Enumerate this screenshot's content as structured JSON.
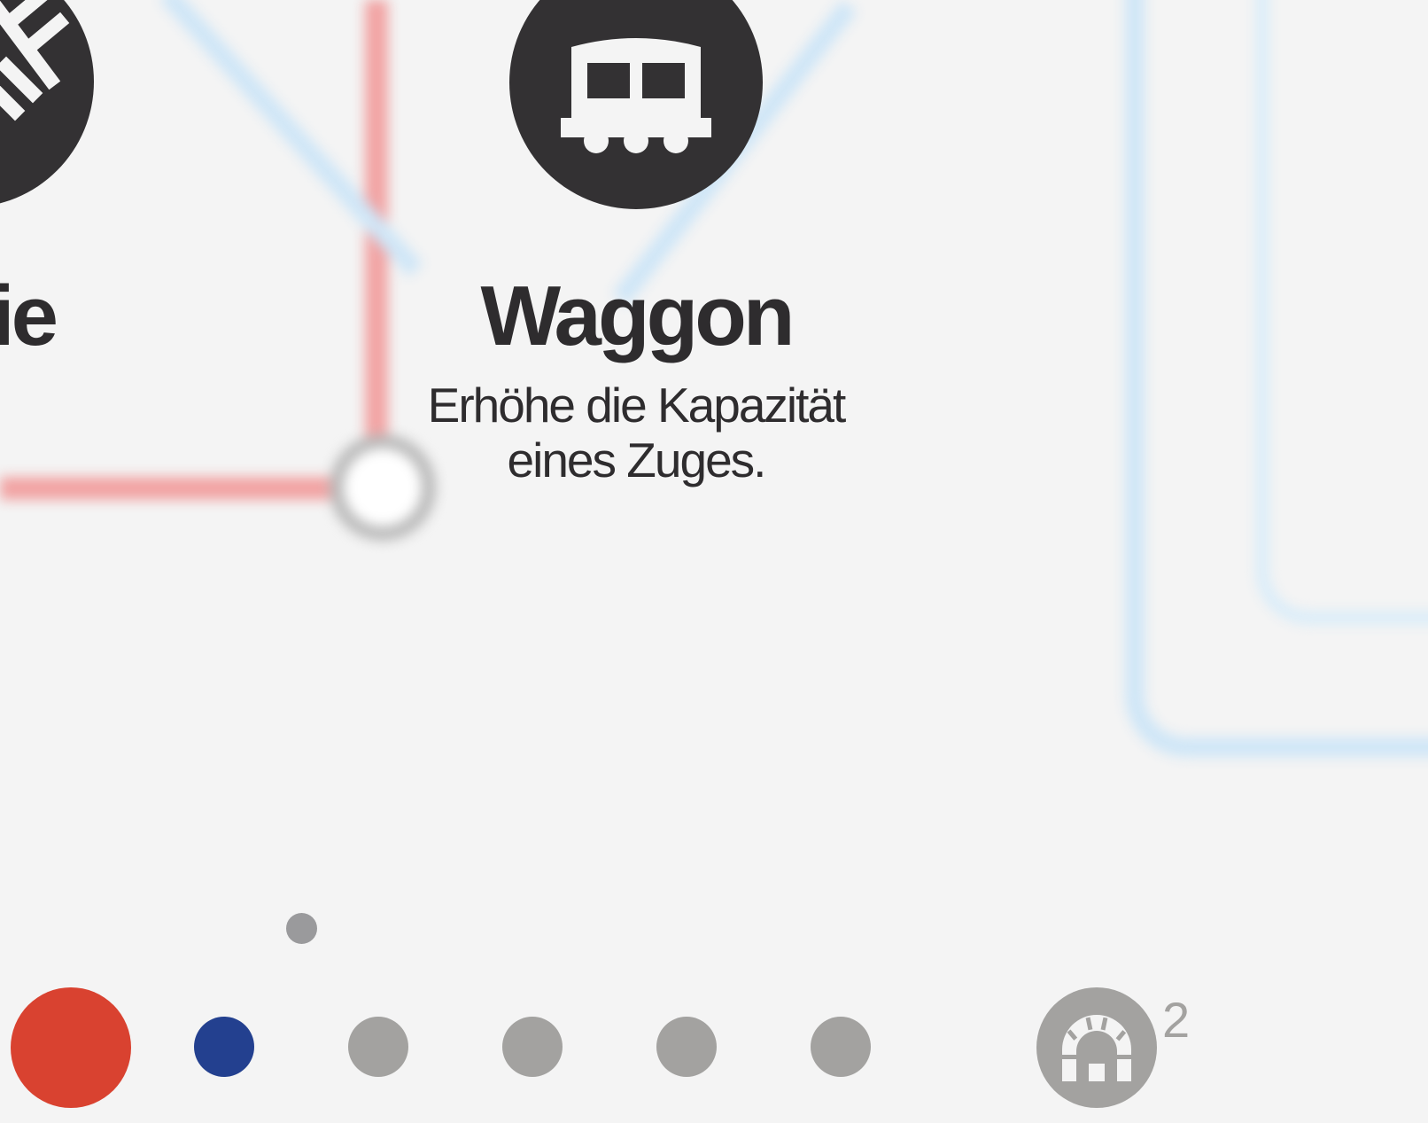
{
  "upgrades": {
    "left_partial": {
      "title_fragment": "ie",
      "icon": "crossing-track-icon"
    },
    "waggon": {
      "title": "Waggon",
      "description_line1": "Erhöhe die Kapazität",
      "description_line2": "eines Zuges.",
      "icon": "waggon-icon"
    }
  },
  "page_indicator": {
    "color": "#9a9a9c"
  },
  "line_palette": {
    "items": [
      {
        "name": "red-line-dot",
        "color": "#d94230",
        "state": "selected"
      },
      {
        "name": "blue-line-dot",
        "color": "#23408f",
        "state": "active"
      },
      {
        "name": "unused-line-dot-1",
        "color": "#a3a2a0",
        "state": "locked"
      },
      {
        "name": "unused-line-dot-2",
        "color": "#a3a2a0",
        "state": "locked"
      },
      {
        "name": "unused-line-dot-3",
        "color": "#a3a2a0",
        "state": "locked"
      },
      {
        "name": "unused-line-dot-4",
        "color": "#a3a2a0",
        "state": "locked"
      }
    ]
  },
  "tunnels": {
    "icon": "tunnel-icon",
    "count": "2"
  },
  "colors": {
    "background": "#f4f4f4",
    "card_dark": "#333133",
    "red_line": "#f1a3a3",
    "blue_line": "#cfe6f7"
  }
}
